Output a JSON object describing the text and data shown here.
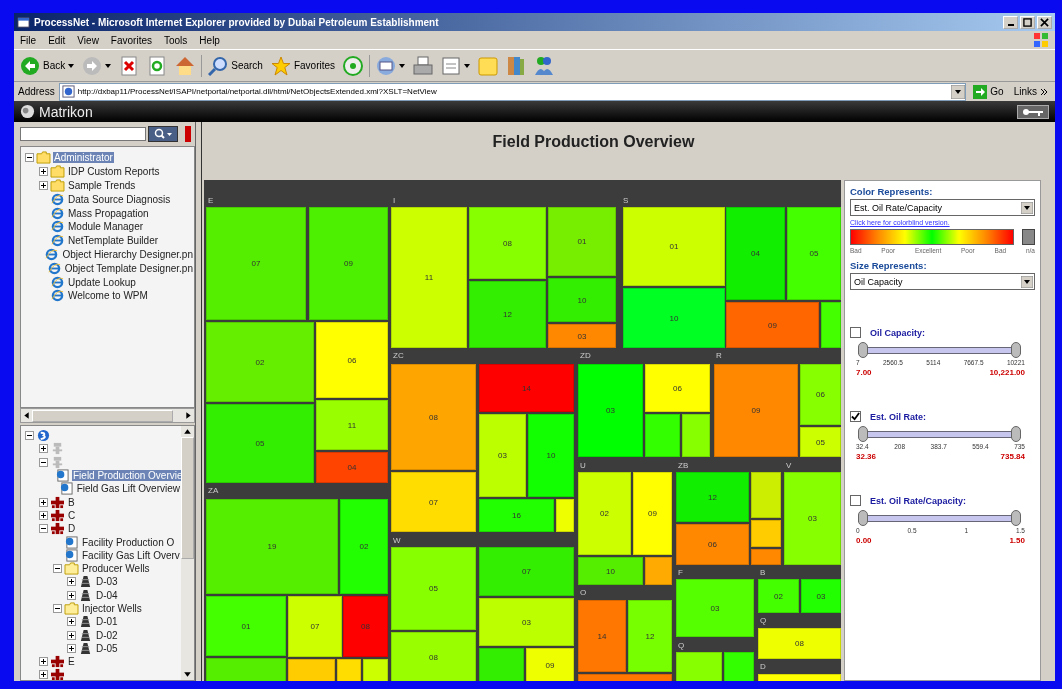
{
  "window": {
    "title": "ProcessNet - Microsoft Internet Explorer provided by Dubai Petroleum Establishment"
  },
  "menu": [
    "File",
    "Edit",
    "View",
    "Favorites",
    "Tools",
    "Help"
  ],
  "toolbar": [
    {
      "kind": "back",
      "label": "Back"
    },
    {
      "kind": "forward"
    },
    {
      "kind": "stop"
    },
    {
      "kind": "refresh"
    },
    {
      "kind": "home"
    },
    {
      "kind": "search",
      "label": "Search"
    },
    {
      "kind": "favorites",
      "label": "Favorites"
    },
    {
      "kind": "media"
    },
    {
      "kind": "mail"
    },
    {
      "kind": "print"
    },
    {
      "kind": "edit"
    },
    {
      "kind": "folder"
    },
    {
      "kind": "research"
    },
    {
      "kind": "messenger"
    }
  ],
  "address": {
    "label": "Address",
    "url": "http://dxbap11/ProcessNet/ISAPI/netportal/netportal.dll/html/NetObjectsExtended.xml?XSLT=NetView",
    "go": "Go",
    "links": "Links"
  },
  "brand": {
    "name": "Matrikon"
  },
  "tree_top": [
    {
      "kind": "folder",
      "label": "Administrator",
      "selected": true,
      "expanded": true,
      "children": [
        {
          "kind": "folder",
          "label": "IDP Custom Reports",
          "selected": false,
          "expanded": false
        },
        {
          "kind": "folder",
          "label": "Sample Trends",
          "selected": false,
          "expanded": false
        },
        {
          "kind": "page",
          "label": "Data Source Diagnosis",
          "selected": false
        },
        {
          "kind": "page",
          "label": "Mass Propagation",
          "selected": false
        },
        {
          "kind": "page",
          "label": "Module Manager",
          "selected": false
        },
        {
          "kind": "page",
          "label": "NetTemplate Builder",
          "selected": false
        },
        {
          "kind": "page",
          "label": "Object Hierarchy Designer.pn",
          "selected": false
        },
        {
          "kind": "page",
          "label": "Object Template Designer.pn",
          "selected": false
        },
        {
          "kind": "page",
          "label": "Update Lookup",
          "selected": false
        },
        {
          "kind": "page",
          "label": "Welcome to WPM",
          "selected": false
        }
      ]
    }
  ],
  "tree_bottom": [
    {
      "kind": "root",
      "expanded": true,
      "children": [
        {
          "kind": "node",
          "expanded": false
        },
        {
          "kind": "node",
          "expanded": true,
          "children": [
            {
              "kind": "view",
              "label": "Field Production Overvie",
              "selected": true
            },
            {
              "kind": "view",
              "label": "Field Gas Lift Overview",
              "selected": false
            }
          ]
        },
        {
          "kind": "facility",
          "label": "B",
          "selected": false,
          "expanded": false
        },
        {
          "kind": "facility",
          "label": "C",
          "selected": false,
          "expanded": false
        },
        {
          "kind": "facility",
          "label": "D",
          "selected": false,
          "expanded": true,
          "children": [
            {
              "kind": "view",
              "label": "Facility Production O",
              "selected": false
            },
            {
              "kind": "view",
              "label": "Facility Gas Lift Overv",
              "selected": false
            },
            {
              "kind": "folder",
              "label": "Producer Wells",
              "selected": false,
              "expanded": true,
              "children": [
                {
                  "kind": "well",
                  "label": "D-03",
                  "selected": false,
                  "expanded": false
                },
                {
                  "kind": "well",
                  "label": "D-04",
                  "selected": false,
                  "expanded": false
                }
              ]
            },
            {
              "kind": "folder",
              "label": "Injector Wells",
              "selected": false,
              "expanded": true,
              "children": [
                {
                  "kind": "well",
                  "label": "D-01",
                  "selected": false,
                  "expanded": false
                },
                {
                  "kind": "well",
                  "label": "D-02",
                  "selected": false,
                  "expanded": false
                },
                {
                  "kind": "well",
                  "label": "D-05",
                  "selected": false,
                  "expanded": false
                }
              ]
            }
          ]
        },
        {
          "kind": "facility",
          "label": "E",
          "selected": false,
          "expanded": false
        },
        {
          "kind": "facility",
          "expanded": false
        }
      ]
    }
  ],
  "page": {
    "title": "Field Production Overview"
  },
  "treemap": {
    "groups": [
      {
        "label": "E",
        "cells": [
          {
            "label": "07",
            "color": "#55ee00"
          },
          {
            "label": "09",
            "color": "#4cf000"
          },
          {
            "label": "02",
            "color": "#66ee00"
          },
          {
            "label": "06",
            "color": "#ffff00"
          },
          {
            "label": "11",
            "color": "#99ff00"
          },
          {
            "label": "05",
            "color": "#33ee00"
          },
          {
            "label": "04",
            "color": "#ff4400"
          }
        ]
      },
      {
        "label": "ZA",
        "cells": [
          {
            "label": "19",
            "color": "#55ee00"
          },
          {
            "label": "02",
            "color": "#22ff00"
          },
          {
            "label": "01",
            "color": "#44ff00"
          },
          {
            "label": "07",
            "color": "#ccff00"
          },
          {
            "label": "08",
            "color": "#ff0000"
          },
          {
            "color": "#55ee00"
          },
          {
            "color": "#ffcc00"
          },
          {
            "color": "#ffdd00"
          },
          {
            "color": "#ccff00"
          }
        ]
      },
      {
        "label": "I",
        "cells": [
          {
            "label": "11",
            "color": "#ccff00"
          },
          {
            "label": "08",
            "color": "#88ff00"
          },
          {
            "label": "12",
            "color": "#33ee00"
          },
          {
            "label": "01",
            "color": "#77ee00"
          },
          {
            "label": "10",
            "color": "#33ee01"
          },
          {
            "label": "03",
            "color": "#ff8800"
          }
        ]
      },
      {
        "label": "S",
        "cells": [
          {
            "label": "01",
            "color": "#ccff00"
          },
          {
            "label": "10",
            "color": "#00ff22"
          },
          {
            "label": "04",
            "color": "#11ee00"
          },
          {
            "label": "05",
            "color": "#44ff00"
          },
          {
            "label": "09",
            "color": "#ff6600"
          },
          {
            "color": "#44ff00"
          }
        ]
      },
      {
        "label": "ZC",
        "cells": [
          {
            "label": "08",
            "color": "#ffa500"
          },
          {
            "label": "14",
            "color": "#ff0000"
          },
          {
            "label": "03",
            "color": "#bbff00"
          },
          {
            "label": "10",
            "color": "#11ff00"
          },
          {
            "label": "07",
            "color": "#ffdd00"
          },
          {
            "label": "16",
            "color": "#22ff00"
          },
          {
            "color": "#eeff00"
          }
        ]
      },
      {
        "label": "ZD",
        "cells": [
          {
            "label": "03",
            "color": "#00ff00"
          },
          {
            "label": "06",
            "color": "#ffff00"
          },
          {
            "color": "#33ff00"
          },
          {
            "color": "#88ff00"
          }
        ]
      },
      {
        "label": "R",
        "cells": [
          {
            "label": "09",
            "color": "#ff8800"
          },
          {
            "label": "06",
            "color": "#88ff00"
          },
          {
            "label": "05",
            "color": "#ccff00"
          }
        ]
      },
      {
        "label": "W",
        "cells": [
          {
            "label": "05",
            "color": "#88ff00"
          },
          {
            "label": "07",
            "color": "#33ee00"
          },
          {
            "label": "03",
            "color": "#bbff00"
          },
          {
            "label": "08",
            "color": "#99ff00"
          },
          {
            "color": "#33ee00"
          },
          {
            "label": "09",
            "color": "#eeff00"
          }
        ]
      },
      {
        "label": "U",
        "cells": [
          {
            "label": "02",
            "color": "#ccff00"
          },
          {
            "label": "09",
            "color": "#ffff00"
          },
          {
            "label": "10",
            "color": "#55ee00"
          },
          {
            "color": "#ffaa00"
          }
        ]
      },
      {
        "label": "O",
        "cells": [
          {
            "label": "14",
            "color": "#ff7700"
          },
          {
            "label": "12",
            "color": "#77ff00"
          },
          {
            "color": "#ff7700"
          }
        ]
      },
      {
        "label": "ZB",
        "cells": [
          {
            "label": "12",
            "color": "#11ee00"
          },
          {
            "label": "06",
            "color": "#ff8800"
          },
          {
            "color": "#ccee00"
          },
          {
            "color": "#ffcc00"
          },
          {
            "color": "#ff8800"
          }
        ]
      },
      {
        "label": "V",
        "cells": [
          {
            "label": "03",
            "color": "#88ff00"
          }
        ]
      },
      {
        "label": "F",
        "cells": [
          {
            "label": "03",
            "color": "#55ff00"
          }
        ]
      },
      {
        "label": "Q",
        "cells": [
          {
            "color": "#88ff00"
          },
          {
            "color": "#33ff00"
          }
        ]
      },
      {
        "label": "B",
        "cells": [
          {
            "label": "02",
            "color": "#44ff00"
          },
          {
            "label": "03",
            "color": "#22ff00"
          }
        ]
      },
      {
        "label": "Q",
        "cells": [
          {
            "label": "08",
            "color": "#eeff00"
          }
        ]
      },
      {
        "label": "D",
        "cells": [
          {
            "color": "#ffff00"
          }
        ]
      }
    ]
  },
  "controls": {
    "color_label": "Color Represents:",
    "color_select": "Est. Oil Rate/Capacity",
    "colorblind_link": "Click here for colorblind version.",
    "legend": [
      "Bad",
      "Poor",
      "Excellent",
      "Poor",
      "Bad",
      "n/a"
    ],
    "size_label": "Size Represents:",
    "size_select": "Oil Capacity",
    "filters": [
      {
        "label": "Oil Capacity:",
        "checked": false,
        "level": 1,
        "ticks": [
          "7",
          "2560.5",
          "5114",
          "7667.5",
          "10221"
        ],
        "min": "7.00",
        "max": "10,221.00"
      },
      {
        "label": "Est. Oil Rate:",
        "checked": true,
        "level": 1,
        "ticks": [
          "32.4",
          "208",
          "383.7",
          "559.4",
          "735"
        ],
        "min": "32.36",
        "max": "735.84"
      },
      {
        "label": "Est. Oil Rate/Capacity:",
        "checked": false,
        "level": 1,
        "ticks": [
          "0",
          "0.5",
          "1",
          "1.5"
        ],
        "min": "0.00",
        "max": "1.50"
      }
    ]
  }
}
